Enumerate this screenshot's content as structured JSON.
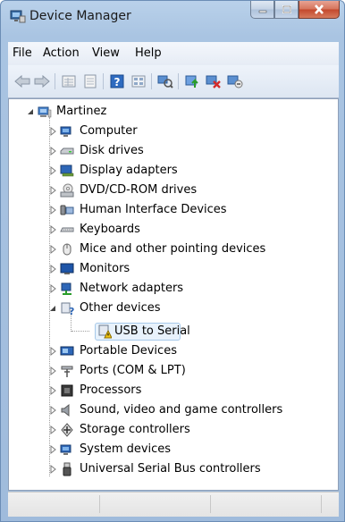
{
  "window": {
    "title": "Device Manager"
  },
  "menu": [
    "File",
    "Action",
    "View",
    "Help"
  ],
  "toolbar": [
    "back-arrow-icon",
    "forward-arrow-icon",
    "properties-grid-icon",
    "show-hidden-icon",
    "help-icon",
    "view-grid-icon",
    "scan-hardware-icon",
    "update-driver-icon",
    "disable-device-icon",
    "uninstall-device-icon"
  ],
  "tree": {
    "root": "Martinez",
    "categories": [
      {
        "label": "Computer",
        "icon": "computer-icon"
      },
      {
        "label": "Disk drives",
        "icon": "disk-drive-icon"
      },
      {
        "label": "Display adapters",
        "icon": "display-adapter-icon"
      },
      {
        "label": "DVD/CD-ROM drives",
        "icon": "dvd-drive-icon"
      },
      {
        "label": "Human Interface Devices",
        "icon": "hid-icon"
      },
      {
        "label": "Keyboards",
        "icon": "keyboard-icon"
      },
      {
        "label": "Mice and other pointing devices",
        "icon": "mouse-icon"
      },
      {
        "label": "Monitors",
        "icon": "monitor-icon"
      },
      {
        "label": "Network adapters",
        "icon": "network-adapter-icon"
      },
      {
        "label": "Other devices",
        "icon": "other-devices-icon",
        "expanded": true,
        "children": [
          {
            "label": "USB to Serial",
            "icon": "unknown-device-warning-icon",
            "selected": true
          }
        ]
      },
      {
        "label": "Portable Devices",
        "icon": "portable-device-icon"
      },
      {
        "label": "Ports (COM & LPT)",
        "icon": "port-icon"
      },
      {
        "label": "Processors",
        "icon": "processor-icon"
      },
      {
        "label": "Sound, video and game controllers",
        "icon": "sound-icon"
      },
      {
        "label": "Storage controllers",
        "icon": "storage-controller-icon"
      },
      {
        "label": "System devices",
        "icon": "system-device-icon"
      },
      {
        "label": "Universal Serial Bus controllers",
        "icon": "usb-icon"
      }
    ]
  }
}
